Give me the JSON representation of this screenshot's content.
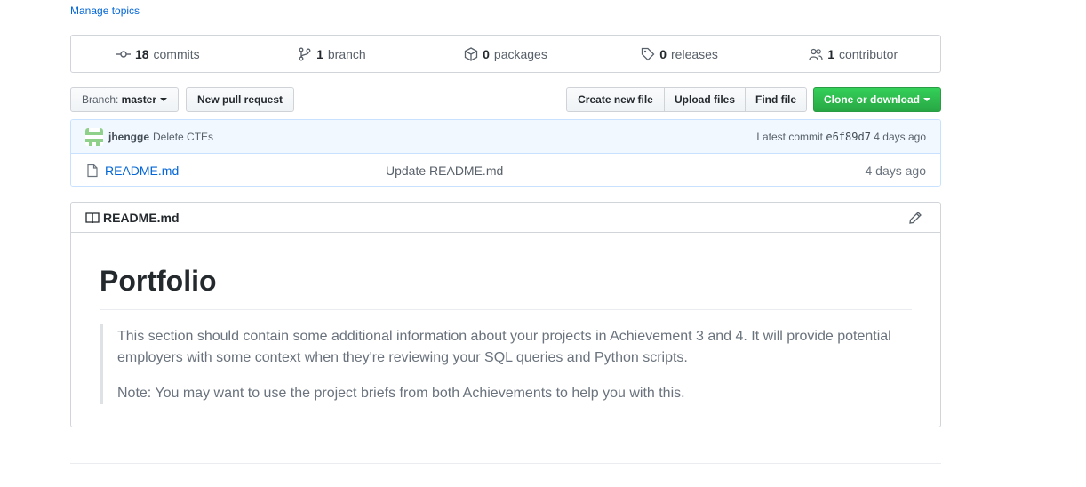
{
  "topics": {
    "manage_label": "Manage topics"
  },
  "numbers_summary": {
    "commits": {
      "count": "18",
      "label": "commits",
      "icon": "commit-icon"
    },
    "branch": {
      "count": "1",
      "label": "branch",
      "icon": "branch-icon"
    },
    "packages": {
      "count": "0",
      "label": "packages",
      "icon": "package-icon"
    },
    "releases": {
      "count": "0",
      "label": "releases",
      "icon": "tag-icon"
    },
    "contributor": {
      "count": "1",
      "label": "contributor",
      "icon": "people-icon"
    }
  },
  "file_nav": {
    "branch_prefix": "Branch:",
    "branch_name": "master",
    "new_pr_label": "New pull request",
    "create_file_label": "Create new file",
    "upload_files_label": "Upload files",
    "find_file_label": "Find file",
    "clone_label": "Clone or download"
  },
  "latest_commit": {
    "author": "jhengge",
    "message": "Delete CTEs",
    "prefix": "Latest commit",
    "sha": "e6f89d7",
    "age": "4 days ago"
  },
  "files": [
    {
      "name": "README.md",
      "message": "Update README.md",
      "age": "4 days ago",
      "icon": "file-icon"
    }
  ],
  "readme": {
    "filename": "README.md",
    "title": "Portfolio",
    "paragraphs": [
      "This section should contain some additional information about your projects in Achievement 3 and 4. It will provide potential employers with some context when they're reviewing your SQL queries and Python scripts.",
      "Note: You may want to use the project briefs from both Achievements to help you with this."
    ]
  },
  "colors": {
    "link": "#0366d6",
    "clone_button": "#2ea44f",
    "commit_bar_bg": "#f1f8ff",
    "avatar": "#8fd18b"
  }
}
